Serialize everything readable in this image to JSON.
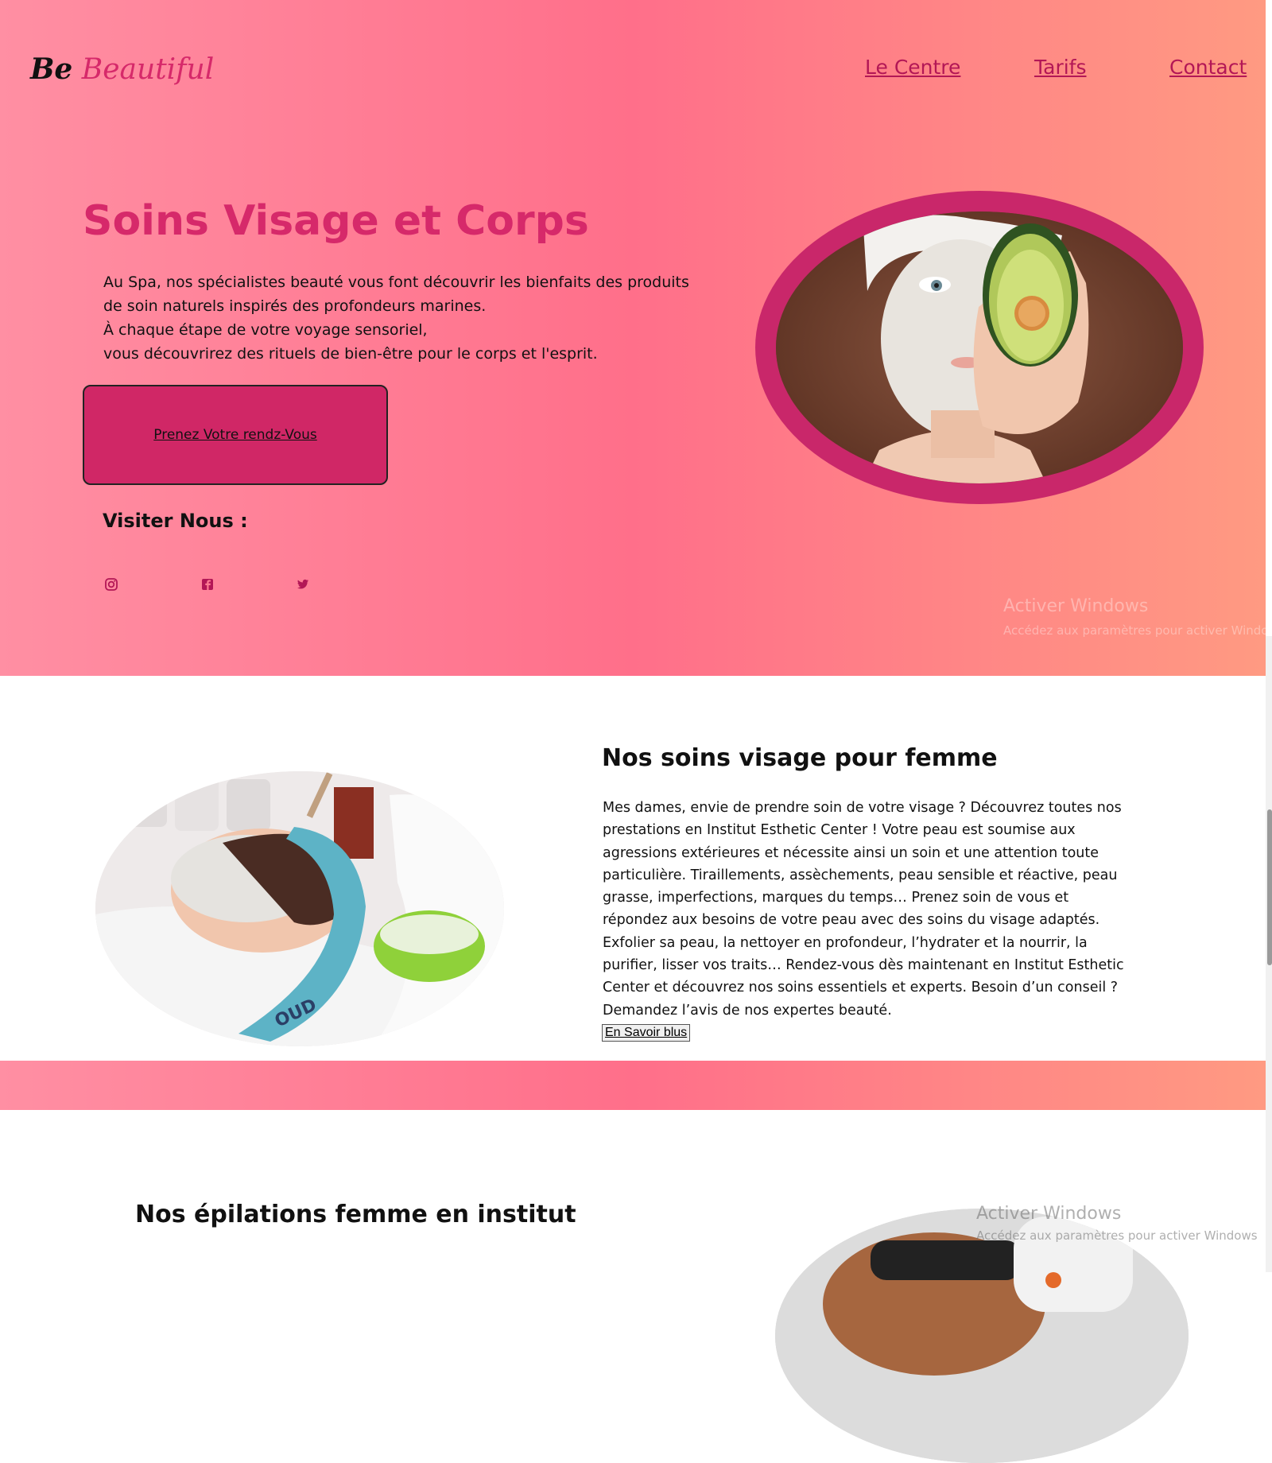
{
  "brand": {
    "logo_part1": "Be",
    "logo_part2": "Beautiful"
  },
  "nav": {
    "items": [
      "Le Centre",
      "Tarifs",
      "Contact"
    ]
  },
  "hero": {
    "title": "Soins Visage et Corps",
    "paragraph_lines": [
      "Au Spa, nos spécialistes beauté vous font découvrir les bienfaits des produits",
      "de soin naturels inspirés des profondeurs marines.",
      "À chaque étape de votre voyage sensoriel,",
      "vous découvrirez des rituels de bien-être pour le corps et l'esprit."
    ],
    "cta_label": "Prenez Votre rendz-Vous",
    "visit_label": "Visiter Nous :",
    "social_icons": [
      "instagram-icon",
      "facebook-icon",
      "twitter-icon"
    ]
  },
  "section_visage": {
    "title": "Nos soins visage pour femme",
    "text": "Mes dames, envie de prendre soin de votre visage ? Découvrez toutes nos prestations en Institut Esthetic Center ! Votre peau est soumise aux agressions extérieures et nécessite ainsi un soin et une attention toute particulière. Tiraillements, assèchements, peau sensible et réactive, peau grasse, imperfections, marques du temps… Prenez soin de vous et répondez aux besoins de votre peau avec des soins du visage adaptés. Exfolier sa peau, la nettoyer en profondeur, l’hydrater et la nourrir, la purifier, lisser vos traits… Rendez-vous dès maintenant en Institut Esthetic Center et découvrez nos soins essentiels et experts. Besoin d’un conseil ? Demandez l’avis de nos expertes beauté.",
    "button_label": "En Savoir blus",
    "towel_text": "OUD"
  },
  "section_epilation": {
    "title": "Nos épilations femme en institut"
  },
  "watermark": {
    "title": "Activer Windows",
    "subtitle": "Accédez aux paramètres pour activer Windows"
  },
  "colors": {
    "accent": "#d6296a",
    "button": "#d02766",
    "gradient": [
      "#ff8fa3",
      "#ff6f8a",
      "#ff9a82"
    ]
  }
}
